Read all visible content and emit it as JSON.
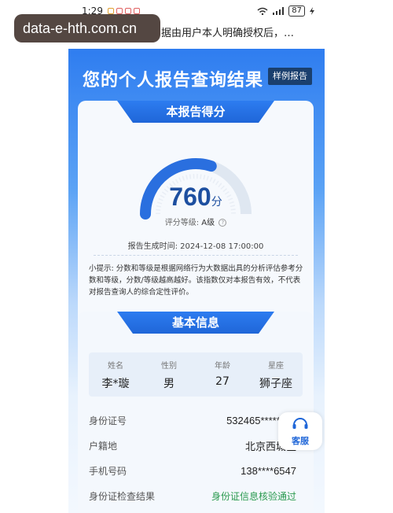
{
  "statusbar": {
    "time": "1:29",
    "battery": "87"
  },
  "notice": "据由用户本人明确授权后，…",
  "watermark": "data-e-hth.com.cn",
  "hero": {
    "title": "您的个人报告查询结果",
    "sample_button": "样例报告"
  },
  "score_card": {
    "heading": "本报告得分",
    "score": "760",
    "unit": "分",
    "grade_label": "评分等级:",
    "grade_value": "A级",
    "generated": "报告生成时间:  2024-12-08  17:00:00",
    "score_fraction": 0.6,
    "tip": "小提示: 分数和等级是根据网络行为大数据出具的分析评估参考分数和等级，分数/等级越高越好。该指数仅对本报告有效，不代表对报告查询人的综合定性评价。"
  },
  "basic_info": {
    "heading": "基本信息",
    "headers": [
      "姓名",
      "性别",
      "年龄",
      "星座"
    ],
    "values": [
      "李*璇",
      "男",
      "27",
      "狮子座"
    ],
    "rows": [
      {
        "label": "身份证号",
        "value": "532465*********"
      },
      {
        "label": "户籍地",
        "value": "北京西城区"
      },
      {
        "label": "手机号码",
        "value": "138****6547"
      },
      {
        "label": "身份证检查结果",
        "value": "身份证信息核验通过"
      }
    ]
  },
  "service": {
    "label": "客服"
  },
  "colors": {
    "primary": "#1f66d8",
    "score": "#1d4fa0",
    "success": "#2a9a4e"
  }
}
